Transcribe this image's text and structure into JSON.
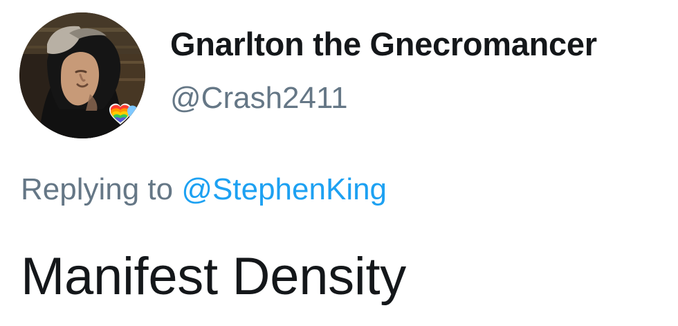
{
  "author": {
    "display_name": "Gnarlton the Gnecromancer",
    "handle": "@Crash2411",
    "avatar_icon": "profile-photo-avatar"
  },
  "reply": {
    "prefix": "Replying to",
    "target_handle": "@StephenKing"
  },
  "tweet": {
    "text": "Manifest Density"
  },
  "colors": {
    "primary_text": "#14171a",
    "secondary_text": "#657786",
    "link": "#1da1f2",
    "background": "#ffffff"
  }
}
